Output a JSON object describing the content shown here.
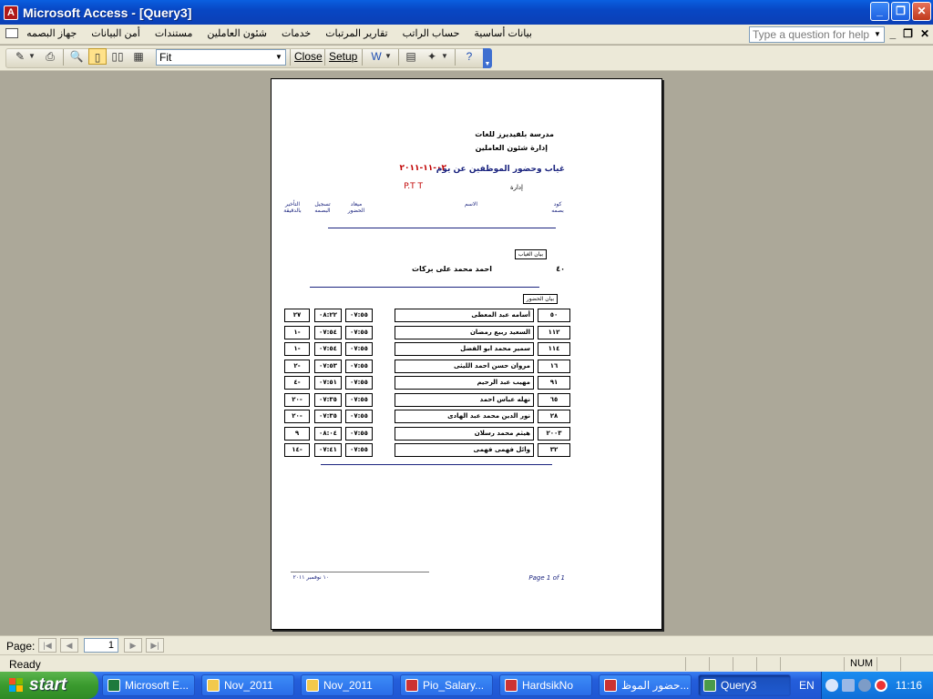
{
  "window": {
    "title": "Microsoft Access - [Query3]"
  },
  "menu": {
    "items": [
      "بيانات أساسية",
      "حساب الراتب",
      "تقارير المرتبات",
      "خدمات",
      "شئون العاملين",
      "مستندات",
      "أمن البيانات",
      "جهاز البصمه"
    ],
    "help_placeholder": "Type a question for help"
  },
  "toolbar": {
    "zoom": "Fit",
    "close_label": "Close",
    "setup_label": "Setup"
  },
  "report": {
    "school": "مدرسة بلفيديرز للغات",
    "department": "إدارة شئون العاملين",
    "title": "غياب وحضور الموظفين عن يوم",
    "date": "٠٢-١١-٢٠١١",
    "dept_label": "إدارة",
    "dept_value": "P.T T",
    "headers": {
      "code": "كود بصمه",
      "name": "الاسم",
      "arrival": "ميعاد الحضور",
      "actual": "تسجيل البصمه",
      "delay": "التأخير بالدقيقة"
    },
    "absence_label": "بيان الغياب",
    "absent": {
      "code": "٤٠",
      "name": "احمد محمد على بركات"
    },
    "attendance_label": "بيان الحضور",
    "rows": [
      {
        "code": "٥٠",
        "name": "أسامه عبد المعطى",
        "arrival": "٠٧:٥٥",
        "actual": "٠٨:٢٢",
        "delay": "٢٧"
      },
      {
        "code": "١١٢",
        "name": "السعيد ربيع رمضان",
        "arrival": "٠٧:٥٥",
        "actual": "٠٧:٥٤",
        "delay": "-١"
      },
      {
        "code": "١١٤",
        "name": "سمير محمد ابو الفضل",
        "arrival": "٠٧:٥٥",
        "actual": "٠٧:٥٤",
        "delay": "-١"
      },
      {
        "code": "١٦",
        "name": "مروان حسن احمد الليثى",
        "arrival": "٠٧:٥٥",
        "actual": "٠٧:٥٣",
        "delay": "-٢"
      },
      {
        "code": "٩١",
        "name": "مهيب عبد الرحيم",
        "arrival": "٠٧:٥٥",
        "actual": "٠٧:٥١",
        "delay": "-٤"
      },
      {
        "code": "٦٥",
        "name": "نهله عباس احمد",
        "arrival": "٠٧:٥٥",
        "actual": "٠٧:٣٥",
        "delay": "-٢٠"
      },
      {
        "code": "٢٨",
        "name": "نور الدين محمد عبد الهادى",
        "arrival": "٠٧:٥٥",
        "actual": "٠٧:٣٥",
        "delay": "-٢٠"
      },
      {
        "code": "٢٠٠٣",
        "name": "هيثم محمد رسلان",
        "arrival": "٠٧:٥٥",
        "actual": "٠٨:٠٤",
        "delay": "٩"
      },
      {
        "code": "٣٢",
        "name": "وائل فهمى فهمى",
        "arrival": "٠٧:٥٥",
        "actual": "٠٧:٤١",
        "delay": "-١٤"
      }
    ],
    "footer_date": "١٠ نوفمبر ٢٠١١",
    "footer_page": "Page 1 of 1"
  },
  "nav": {
    "label": "Page:",
    "page": "1"
  },
  "status": {
    "text": "Ready",
    "num": "NUM"
  },
  "taskbar": {
    "start": "start",
    "tasks": [
      "Microsoft E...",
      "Nov_2011",
      "Nov_2011",
      "Pio_Salary...",
      "HardsikNo",
      "حضور الموظ...",
      "Query3"
    ],
    "lang": "EN",
    "clock": "11:16"
  }
}
